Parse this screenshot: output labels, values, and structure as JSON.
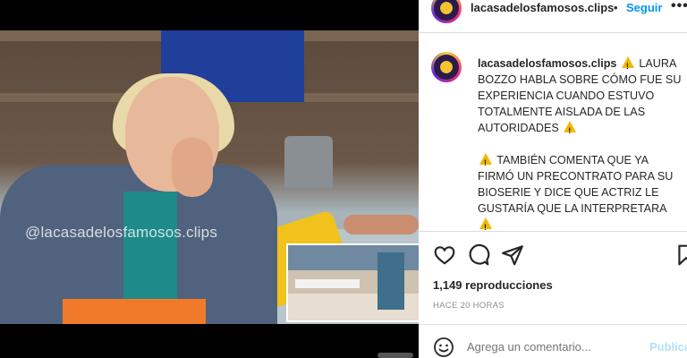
{
  "video": {
    "watermark": "@lacasadelosfamosos.clips"
  },
  "post": {
    "header": {
      "username": "lacasadelosfamosos.clips",
      "separator": "•",
      "follow_label": "Seguir",
      "more_label": "•••"
    },
    "caption": {
      "username": "lacasadelosfamosos.clips",
      "paragraph1": "LAURA BOZZO HABLA SOBRE CÓMO FUE SU EXPERIENCIA CUANDO ESTUVO TOTALMENTE AISLADA DE LAS AUTORIDADES",
      "paragraph2": "TAMBIÉN COMENTA QUE YA FIRMÓ UN PRECONTRATO PARA SU BIOSERIE Y DICE QUE ACTRIZ LE GUSTARÍA QUE LA INTERPRETARA"
    },
    "views": "1,149 reproducciones",
    "time_ago": "HACE 20 HORAS",
    "comment": {
      "placeholder": "Agrega un comentario...",
      "publish_label": "Publicar"
    }
  },
  "colors": {
    "accent": "#0095f6",
    "warning": "#f2b705",
    "text": "#262626",
    "muted": "#8e8e8e"
  }
}
